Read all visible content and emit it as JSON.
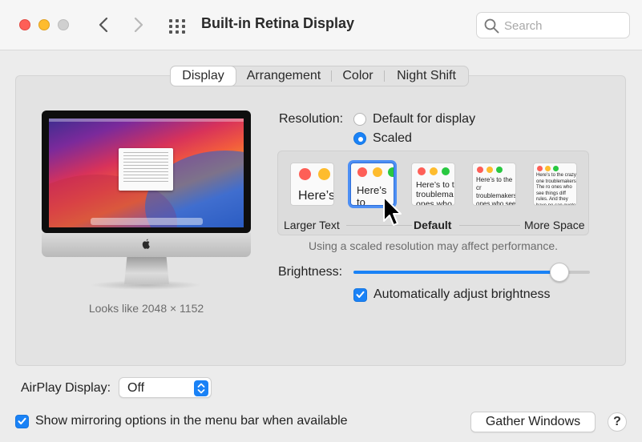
{
  "window": {
    "title": "Built-in Retina Display",
    "search_placeholder": "Search"
  },
  "tabs": [
    {
      "label": "Display",
      "active": true
    },
    {
      "label": "Arrangement",
      "active": false
    },
    {
      "label": "Color",
      "active": false
    },
    {
      "label": "Night Shift",
      "active": false
    }
  ],
  "display": {
    "looks_like": "Looks like 2048 × 1152",
    "resolution_label": "Resolution:",
    "resolution_options": [
      {
        "label": "Default for display",
        "selected": false
      },
      {
        "label": "Scaled",
        "selected": true
      }
    ],
    "scaled_previews": [
      {
        "text": "Here’s",
        "selected": false
      },
      {
        "text": "Here’s to troubl",
        "selected": true
      },
      {
        "text": "Here’s to t troublema ones who",
        "selected": false
      },
      {
        "text": "Here’s to the cr troublemakers. ones who see t rules. And they",
        "selected": false
      },
      {
        "text": "Here’s to the crazy one troublemakers. The ro ones who see things diff rules. And they have no can quote them, disagr them. About the only th Because they change th",
        "selected": false
      }
    ],
    "scale_labels": {
      "left": "Larger Text",
      "center": "Default",
      "right": "More Space"
    },
    "performance_note": "Using a scaled resolution may affect performance.",
    "brightness_label": "Brightness:",
    "brightness_level": 0.87,
    "auto_brightness_label": "Automatically adjust brightness",
    "auto_brightness_checked": true
  },
  "footer": {
    "airplay_label": "AirPlay Display:",
    "airplay_value": "Off",
    "mirroring_label": "Show mirroring options in the menu bar when available",
    "mirroring_checked": true,
    "gather_label": "Gather Windows",
    "help_label": "?"
  },
  "colors": {
    "accent": "#1a82f6",
    "close": "#fe5f57",
    "minimize": "#febc2e",
    "zoom_disabled": "#d0d0d0"
  }
}
